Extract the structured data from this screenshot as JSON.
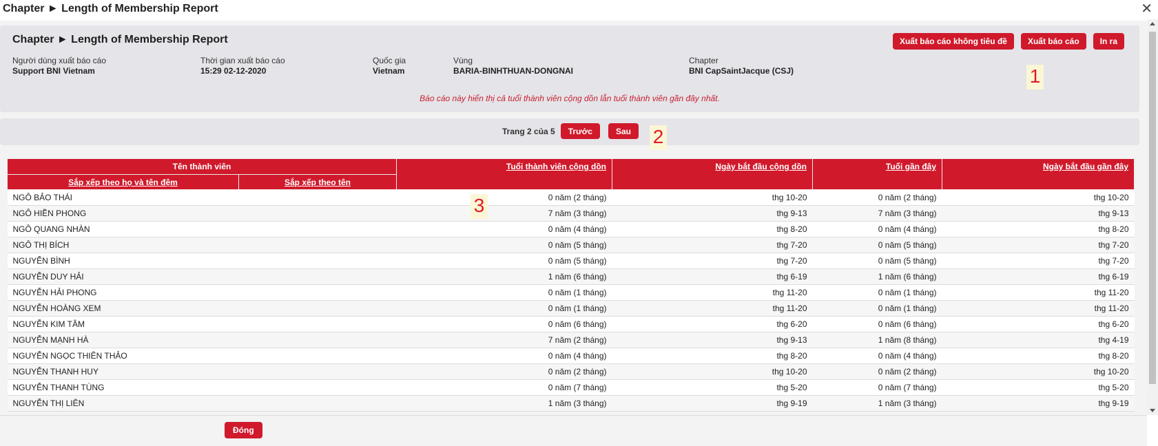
{
  "window": {
    "title": "Chapter ► Length of Membership Report",
    "close_glyph": "✕"
  },
  "header": {
    "title": "Chapter ► Length of Membership Report",
    "buttons": {
      "export_no_title": "Xuất báo cáo không tiêu đề",
      "export": "Xuất báo cáo",
      "print": "In ra"
    },
    "info": [
      {
        "label": "Người dùng xuất báo cáo",
        "value": "Support BNI Vietnam"
      },
      {
        "label": "Thời gian xuất báo cáo",
        "value": "15:29 02-12-2020"
      },
      {
        "label": "Quốc gia",
        "value": "Vietnam"
      },
      {
        "label": "Vùng",
        "value": "BARIA-BINHTHUAN-DONGNAI"
      },
      {
        "label": "Chapter",
        "value": "BNI CapSaintJacque (CSJ)"
      }
    ],
    "note": "Báo cáo này hiển thị cả tuổi thành viên cộng dồn lẫn tuổi thành viên gần đây nhất."
  },
  "annotations": [
    "1",
    "2",
    "3"
  ],
  "pager": {
    "text": "Trang 2 của 5",
    "prev": "Trước",
    "next": "Sau"
  },
  "table": {
    "headers": {
      "member_name": "Tên thành viên",
      "sort_by_surname": "Sắp xếp theo họ và tên đệm",
      "sort_by_firstname": "Sắp xếp theo tên",
      "cumulative_age": "Tuổi thành viên cộng dồn",
      "cumulative_start": "Ngày bắt đầu cộng dồn",
      "recent_age": "Tuổi gần đây",
      "recent_start": "Ngày bắt đầu gần đây"
    },
    "rows": [
      {
        "name": "NGÔ BẢO THÁI",
        "cum_age": "0 năm (2 tháng)",
        "cum_start": "thg 10-20",
        "rec_age": "0 năm (2 tháng)",
        "rec_start": "thg 10-20"
      },
      {
        "name": "NGÔ HIỀN PHONG",
        "cum_age": "7 năm (3 tháng)",
        "cum_start": "thg 9-13",
        "rec_age": "7 năm (3 tháng)",
        "rec_start": "thg 9-13"
      },
      {
        "name": "NGÔ QUANG NHÀN",
        "cum_age": "0 năm (4 tháng)",
        "cum_start": "thg 8-20",
        "rec_age": "0 năm (4 tháng)",
        "rec_start": "thg 8-20"
      },
      {
        "name": "NGÔ THỊ BÍCH",
        "cum_age": "0 năm (5 tháng)",
        "cum_start": "thg 7-20",
        "rec_age": "0 năm (5 tháng)",
        "rec_start": "thg 7-20"
      },
      {
        "name": "NGUYỄN BÌNH",
        "cum_age": "0 năm (5 tháng)",
        "cum_start": "thg 7-20",
        "rec_age": "0 năm (5 tháng)",
        "rec_start": "thg 7-20"
      },
      {
        "name": "NGUYỄN DUY HẢI",
        "cum_age": "1 năm (6 tháng)",
        "cum_start": "thg 6-19",
        "rec_age": "1 năm (6 tháng)",
        "rec_start": "thg 6-19"
      },
      {
        "name": "NGUYỄN HẢI PHONG",
        "cum_age": "0 năm (1 tháng)",
        "cum_start": "thg 11-20",
        "rec_age": "0 năm (1 tháng)",
        "rec_start": "thg 11-20"
      },
      {
        "name": "NGUYỄN HOÀNG XEM",
        "cum_age": "0 năm (1 tháng)",
        "cum_start": "thg 11-20",
        "rec_age": "0 năm (1 tháng)",
        "rec_start": "thg 11-20"
      },
      {
        "name": "NGUYỄN KIM TÂM",
        "cum_age": "0 năm (6 tháng)",
        "cum_start": "thg 6-20",
        "rec_age": "0 năm (6 tháng)",
        "rec_start": "thg 6-20"
      },
      {
        "name": "NGUYỄN MẠNH HÀ",
        "cum_age": "7 năm (2 tháng)",
        "cum_start": "thg 9-13",
        "rec_age": "1 năm (8 tháng)",
        "rec_start": "thg 4-19"
      },
      {
        "name": "NGUYỄN NGỌC THIÊN THẢO",
        "cum_age": "0 năm (4 tháng)",
        "cum_start": "thg 8-20",
        "rec_age": "0 năm (4 tháng)",
        "rec_start": "thg 8-20"
      },
      {
        "name": "NGUYỄN THANH HUY",
        "cum_age": "0 năm (2 tháng)",
        "cum_start": "thg 10-20",
        "rec_age": "0 năm (2 tháng)",
        "rec_start": "thg 10-20"
      },
      {
        "name": "NGUYỄN THANH TÙNG",
        "cum_age": "0 năm (7 tháng)",
        "cum_start": "thg 5-20",
        "rec_age": "0 năm (7 tháng)",
        "rec_start": "thg 5-20"
      },
      {
        "name": "NGUYỄN THỊ  LIÊN",
        "cum_age": "1 năm (3 tháng)",
        "cum_start": "thg 9-19",
        "rec_age": "1 năm (3 tháng)",
        "rec_start": "thg 9-19"
      }
    ]
  },
  "footer": {
    "close": "Đóng"
  },
  "colors": {
    "accent": "#d0192b",
    "panel": "#e4e4e9",
    "note": "#c8202e",
    "annotation": "#e31b23"
  }
}
